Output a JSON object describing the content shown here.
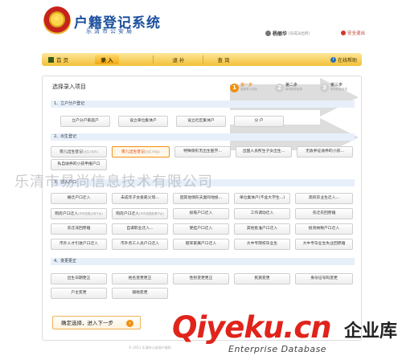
{
  "header": {
    "title": "户籍登记系统",
    "subtitle": "乐清市公安局",
    "user_name": "杨丽华",
    "user_role": "[乐成派出所]",
    "logout": "安全退出"
  },
  "nav": {
    "home": "首 页",
    "tabs": [
      "录 入",
      "退 补",
      "查 询"
    ],
    "help": "在线帮助"
  },
  "panel": {
    "title": "选择录入项目",
    "steps": [
      {
        "num": "1",
        "label": "第一步",
        "sub": "选择录入项目"
      },
      {
        "num": "2",
        "label": "第二步",
        "sub": "填写相关信息"
      },
      {
        "num": "3",
        "label": "第三步",
        "sub": "填写相关信息"
      }
    ],
    "sections": [
      {
        "title": "1、立户分户登记",
        "items": [
          "立户分户家庭户",
          "设立单位集体户",
          "设立社区集体户",
          "分 户"
        ]
      },
      {
        "title": "2、出生登记",
        "items": [
          "婴儿出生登记",
          "婴儿出生登记",
          "特殊情形无出生医学...",
          "出国人员所生子女出生...",
          "无收养证收养的小孩...",
          "私自收养的小孩申报户口"
        ],
        "small": [
          "(出生1年内)",
          "(出生1年后)"
        ]
      },
      {
        "title": "3、迁入户口",
        "items": [
          "婚迁户口迁入",
          "未成年子女投靠父母...",
          "因其他情形夫妻同地投...",
          "单位集体户(不含大学生...)",
          "高校毕业生迁入...",
          "购房户口迁入",
          "购房户口迁入",
          "投靠户口迁入",
          "工作调动迁入",
          "农迁农回原籍",
          "农迁非回原籍",
          "自谋职业迁入...",
          "受挂户口迁入",
          "其他批准户口迁入",
          "投资纳税户口迁入",
          "市外人才引进户口迁入",
          "市外务工人员户口迁入",
          "随军家属户口迁入",
          "大中专院校毕业生",
          "大中专毕业生失业回原籍"
        ],
        "small": [
          "(市内投靠父母子女)",
          "(市内投靠配偶子女)"
        ]
      },
      {
        "title": "4、变更更正",
        "items": [
          "出生日期更正",
          "姓名变更更正",
          "性别变更更正",
          "民族变更",
          "身份证号码变更",
          "户主变更",
          "辅助变更"
        ]
      }
    ],
    "next_button": "确定选择，进入下一步"
  },
  "watermark": "乐清市易尚信息技术有限公司",
  "brand": {
    "logo": "Qiyeku",
    "suffix": ".cn",
    "cn": "企业库",
    "en": "Enterprise Database"
  },
  "footer": "© 2011 乐清市公安局户政科"
}
